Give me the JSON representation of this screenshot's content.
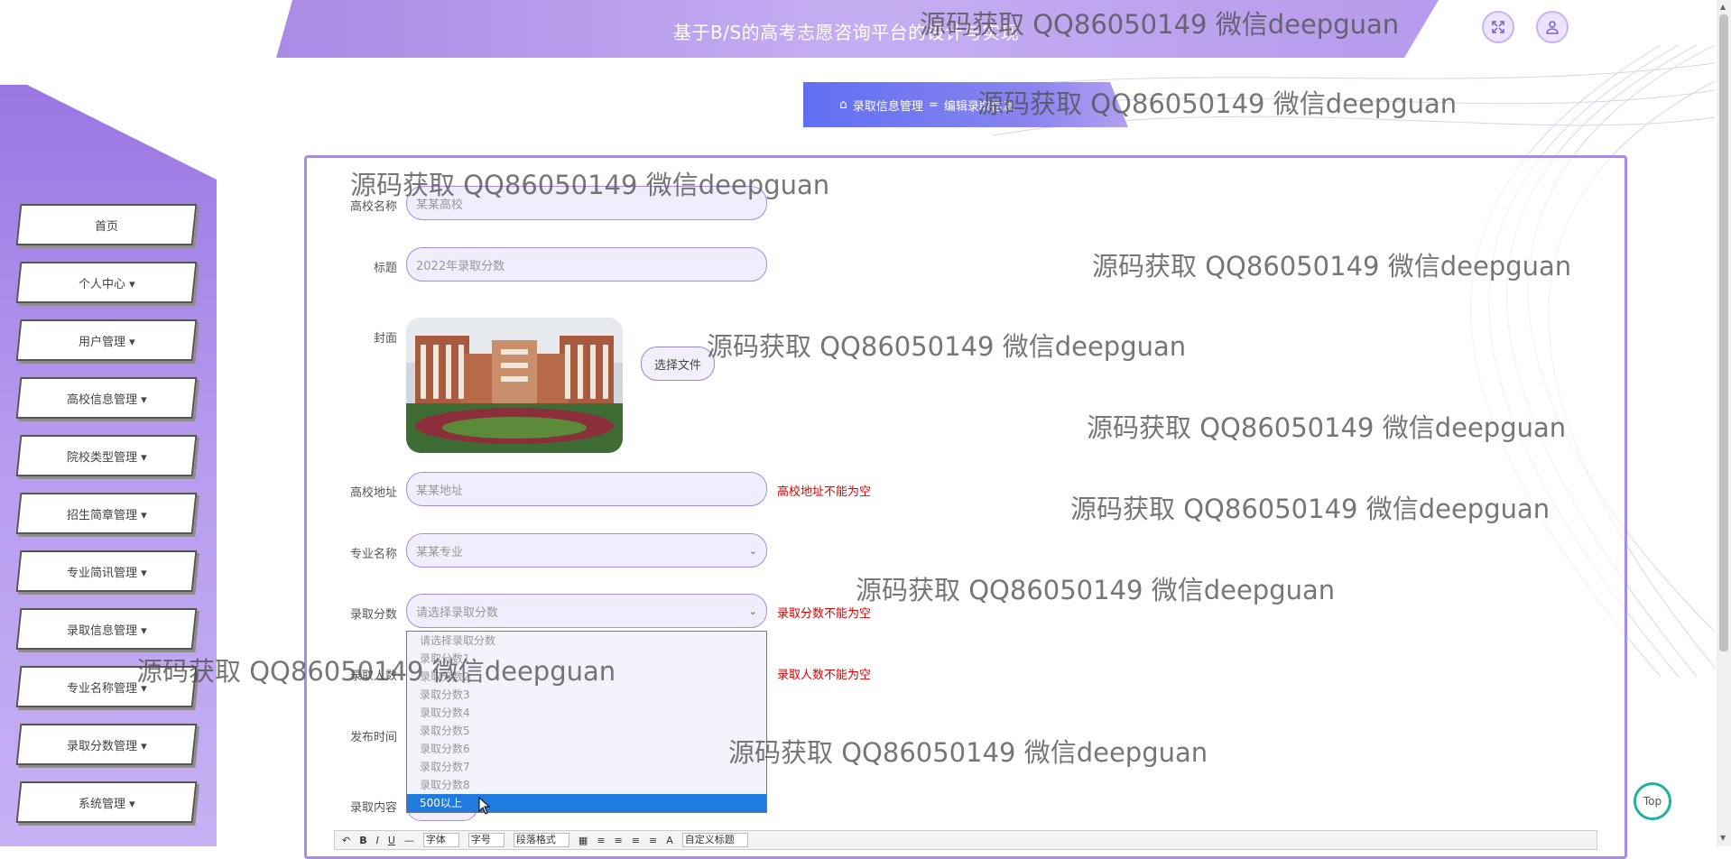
{
  "header": {
    "title": "基于B/S的高考志愿咨询平台的设计与实现"
  },
  "breadcrumb": {
    "home": "录取信息管理",
    "sep": "=",
    "current": "编辑录取信息"
  },
  "sidebar": {
    "items": [
      {
        "label": "首页"
      },
      {
        "label": "个人中心 ▾"
      },
      {
        "label": "用户管理 ▾"
      },
      {
        "label": "高校信息管理 ▾"
      },
      {
        "label": "院校类型管理 ▾"
      },
      {
        "label": "招生简章管理 ▾"
      },
      {
        "label": "专业简讯管理 ▾"
      },
      {
        "label": "录取信息管理 ▾"
      },
      {
        "label": "专业名称管理 ▾"
      },
      {
        "label": "录取分数管理 ▾"
      },
      {
        "label": "系统管理 ▾"
      }
    ]
  },
  "form": {
    "school_label": "高校名称",
    "school_value": "某某高校",
    "title_label": "标题",
    "title_value": "2022年录取分数",
    "cover_label": "封面",
    "file_button": "选择文件",
    "address_label": "高校地址",
    "address_value": "某某地址",
    "address_error": "高校地址不能为空",
    "major_label": "专业名称",
    "major_value": "某某专业",
    "score_label": "录取分数",
    "score_placeholder": "请选择录取分数",
    "score_error": "录取分数不能为空",
    "count_label": "录取人数",
    "count_error": "录取人数不能为空",
    "time_label": "发布时间",
    "content_label": "录取内容"
  },
  "dropdown": {
    "options": [
      "请选择录取分数",
      "录取分数1",
      "录取分数2",
      "录取分数3",
      "录取分数4",
      "录取分数5",
      "录取分数6",
      "录取分数7",
      "录取分数8",
      "500以上"
    ],
    "selected": "500以上"
  },
  "toolbar": {
    "font": "字体",
    "size": "字号",
    "format": "段落格式",
    "custom": "自定义标题"
  },
  "top_button": "Top",
  "watermark": "源码获取 QQ86050149 微信deepguan",
  "colors": {
    "accent": "#a58ce6",
    "error": "#dd0000",
    "selected": "#1f7be0"
  }
}
